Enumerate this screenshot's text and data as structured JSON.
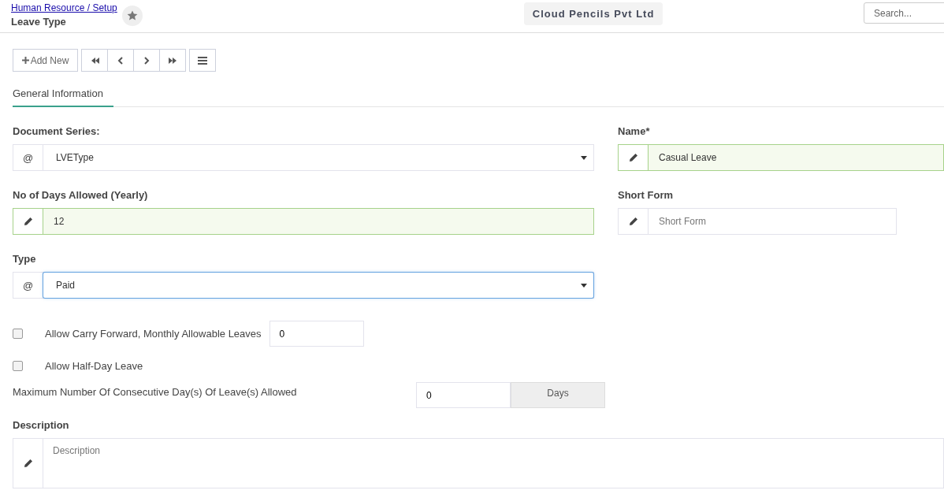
{
  "header": {
    "breadcrumb": "Human Resource / Setup",
    "title": "Leave Type",
    "favorite": false,
    "company": "Cloud Pencils Pvt Ltd",
    "search": {
      "placeholder": "Search..."
    }
  },
  "toolbar": {
    "add_label": "Add New"
  },
  "tabs": [
    {
      "label": "General Information",
      "selected": true
    }
  ],
  "fields": [
    {
      "label": "Document Series:",
      "kind": "select",
      "prefix": "@",
      "value": "LVEType",
      "valid": false,
      "focused": false
    },
    {
      "label": "Name*",
      "kind": "input",
      "value": "Casual Leave",
      "valid": true,
      "focused": false
    },
    {
      "label": "No of Days Allowed (Yearly)",
      "kind": "input",
      "value": "12",
      "valid": true,
      "focused": false
    },
    {
      "label": "Short Form",
      "kind": "input",
      "placeholder": "Short Form",
      "valid": false,
      "focused": false
    },
    {
      "label": "Type",
      "kind": "select",
      "prefix": "@",
      "value": "Paid",
      "valid": false,
      "focused": true
    }
  ],
  "options": [
    {
      "kind": "checkbox",
      "label": "Allow Carry Forward, Monthly Allowable Leaves",
      "checked": false,
      "value": "0"
    },
    {
      "kind": "checkbox",
      "label": "Allow Half-Day Leave",
      "checked": false
    },
    {
      "kind": "number",
      "label": "Maximum Number Of Consecutive Day(s) Of Leave(s) Allowed",
      "value": "0",
      "unit": "Days"
    }
  ],
  "description": {
    "label": "Description",
    "placeholder": "Description"
  }
}
